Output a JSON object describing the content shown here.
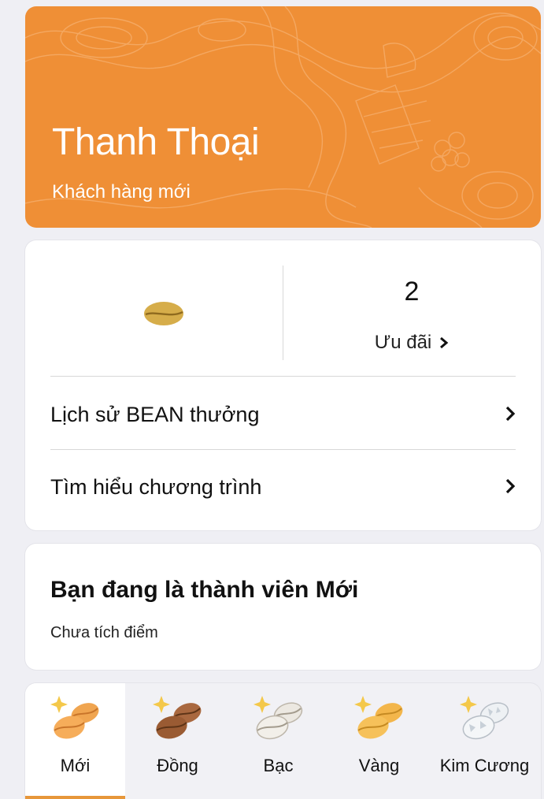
{
  "profile": {
    "name": "Thanh Thoại",
    "tier_label": "Khách hàng mới"
  },
  "points": {
    "bean_icon": "coffee-bean-icon",
    "offers_count": "2",
    "offers_label": "Ưu đãi",
    "rows": [
      {
        "label": "Lịch sử BEAN thưởng"
      },
      {
        "label": "Tìm hiểu chương trình"
      }
    ]
  },
  "membership": {
    "title": "Bạn đang là thành viên Mới",
    "subtitle": "Chưa tích điểm"
  },
  "tiers": [
    {
      "label": "Mới",
      "active": true,
      "color": "#f2a24e"
    },
    {
      "label": "Đồng",
      "active": false,
      "color": "#a9683f"
    },
    {
      "label": "Bạc",
      "active": false,
      "color": "#e9e6e0"
    },
    {
      "label": "Vàng",
      "active": false,
      "color": "#f3b64b"
    },
    {
      "label": "Kim Cương",
      "active": false,
      "color": "#eef1f4"
    }
  ],
  "colors": {
    "banner": "#ef8f36",
    "accent": "#e7973a",
    "background": "#efeff4"
  }
}
